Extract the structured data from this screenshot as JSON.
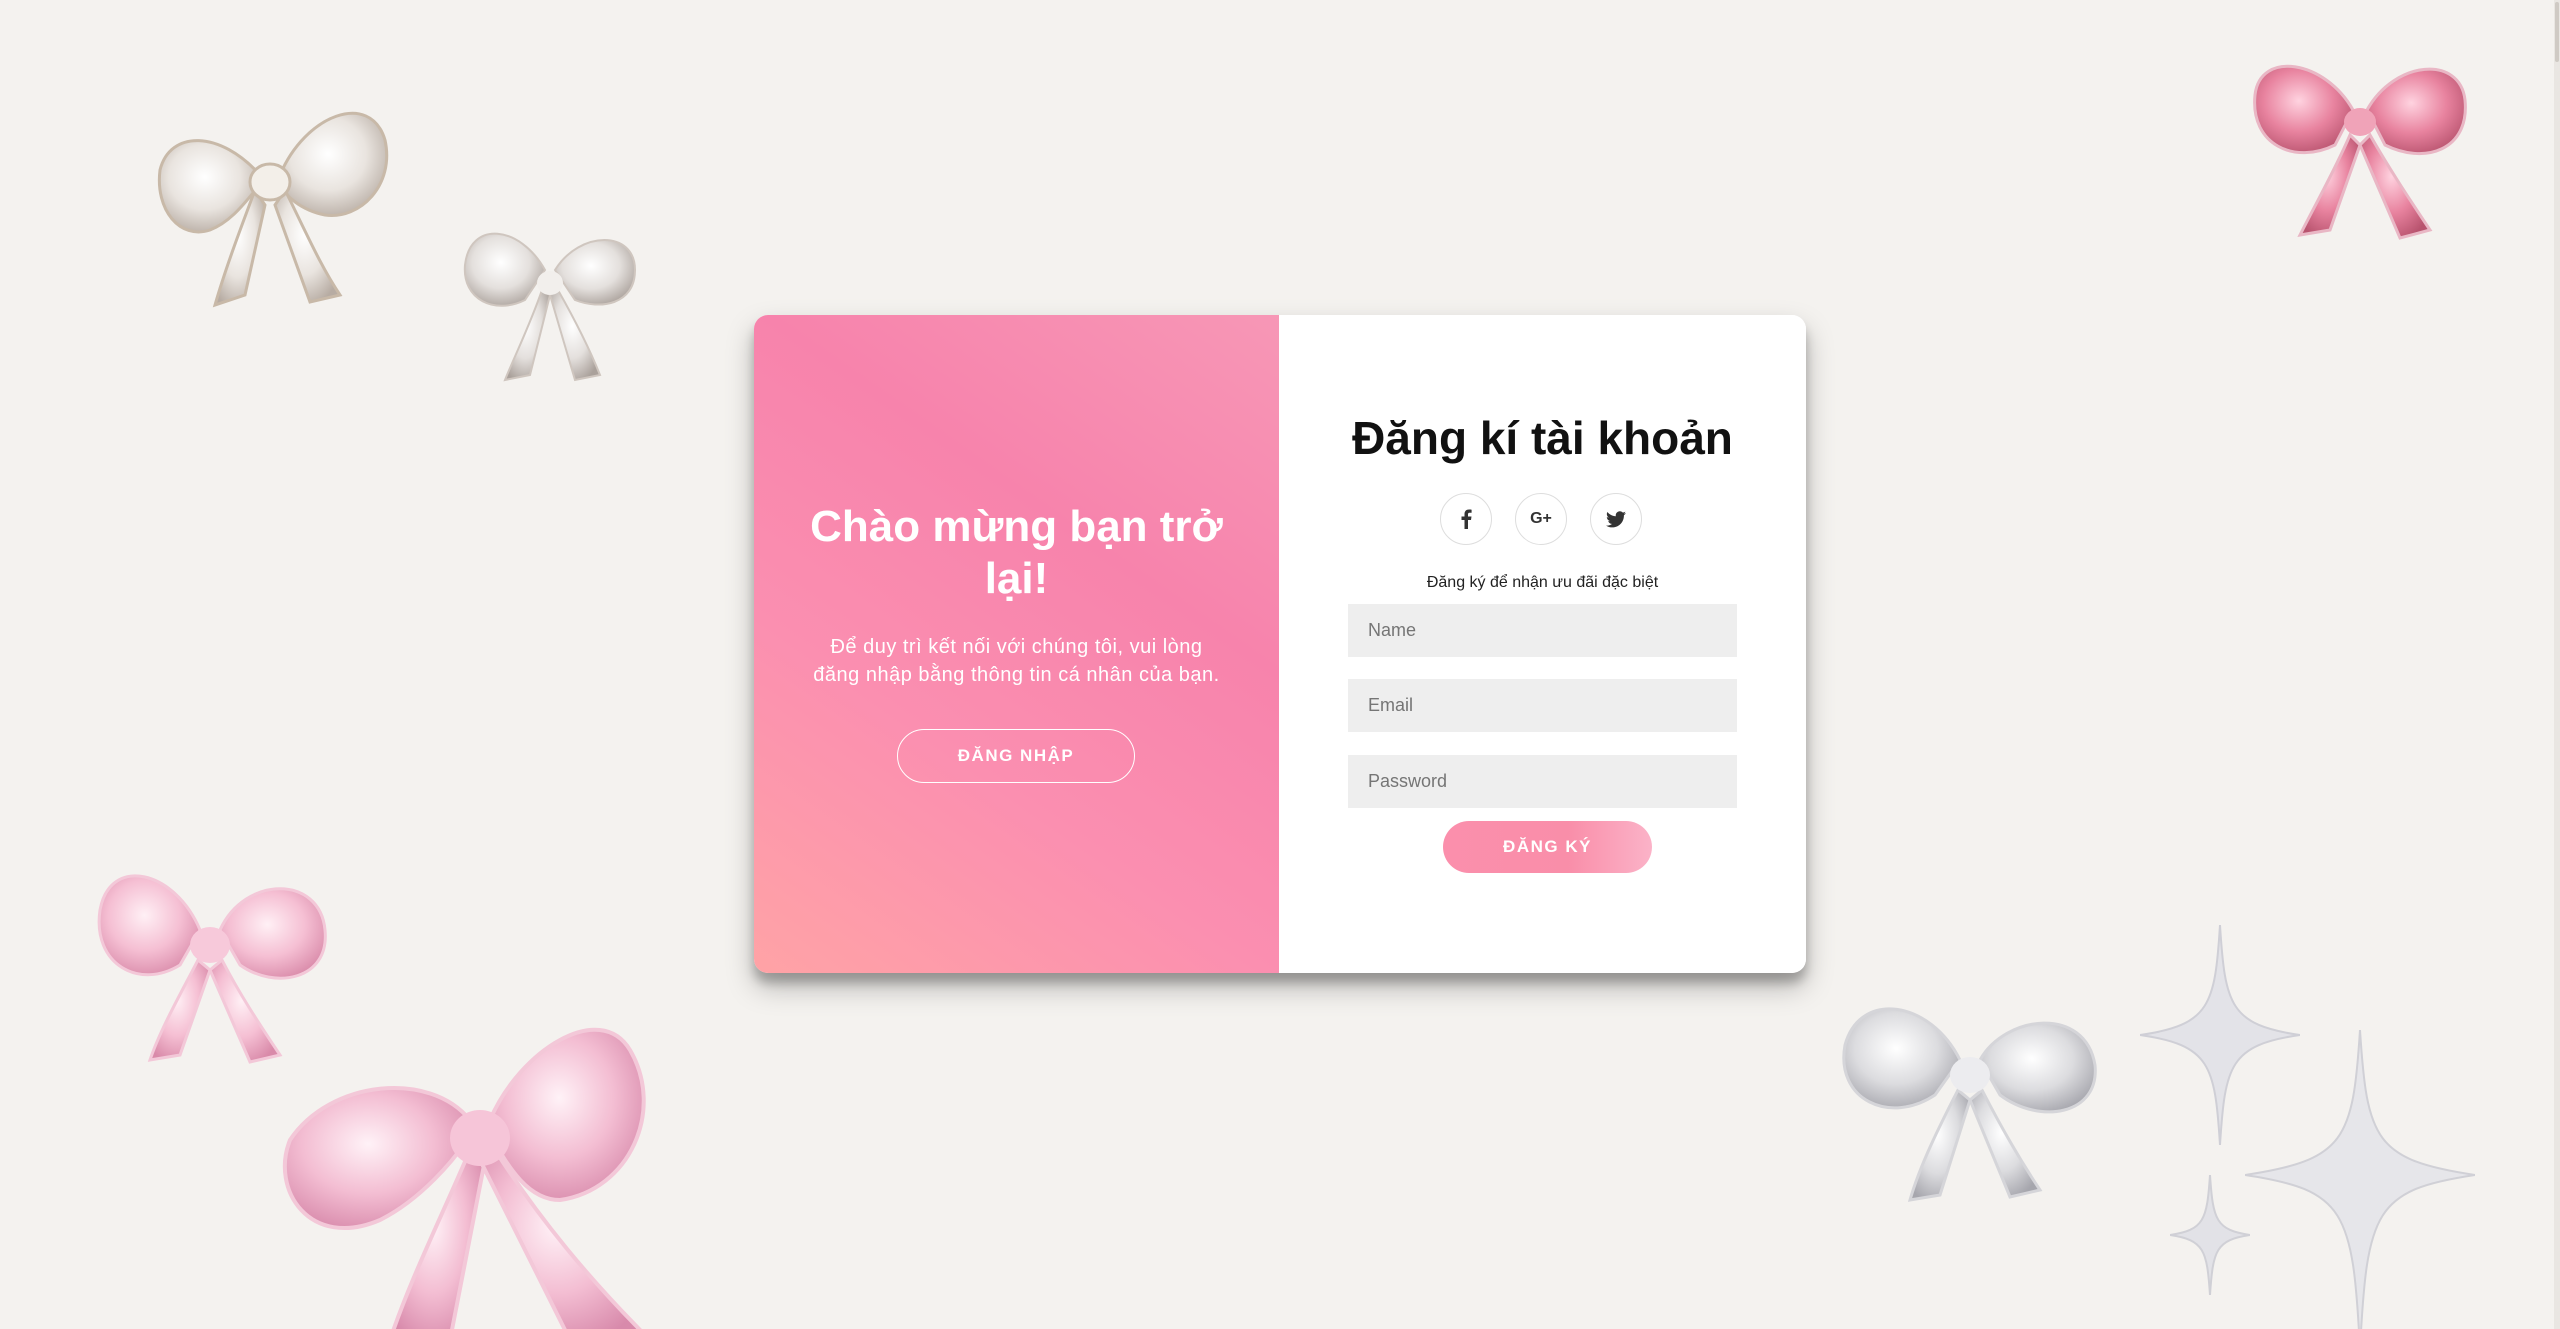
{
  "overlay_left": {
    "title": "Chào mừng bạn trở lại!",
    "text": "Để duy trì kết nối với chúng tôi, vui lòng đăng nhập bằng thông tin cá nhân của bạn.",
    "signin_button": "ĐĂNG NHẬP"
  },
  "signup_form": {
    "title": "Đăng kí tài khoản",
    "social": [
      {
        "name": "facebook",
        "icon": "facebook-icon",
        "glyph": "f"
      },
      {
        "name": "google-plus",
        "icon": "google-plus-icon",
        "glyph": "G+"
      },
      {
        "name": "twitter",
        "icon": "twitter-icon",
        "glyph": ""
      }
    ],
    "subtitle": "Đăng ký để nhận ưu đãi đặc biệt",
    "fields": {
      "name_placeholder": "Name",
      "email_placeholder": "Email",
      "password_placeholder": "Password"
    },
    "submit_button": "ĐĂNG KÝ"
  },
  "colors": {
    "background": "#f4f2ef",
    "overlay_gradient_start": "#ffa3a6",
    "overlay_gradient_mid": "#f783ac",
    "accent_pink": "#fb8fac",
    "input_background": "#eeeeee"
  },
  "decorations": [
    "bow-icon",
    "sparkle-icon"
  ]
}
